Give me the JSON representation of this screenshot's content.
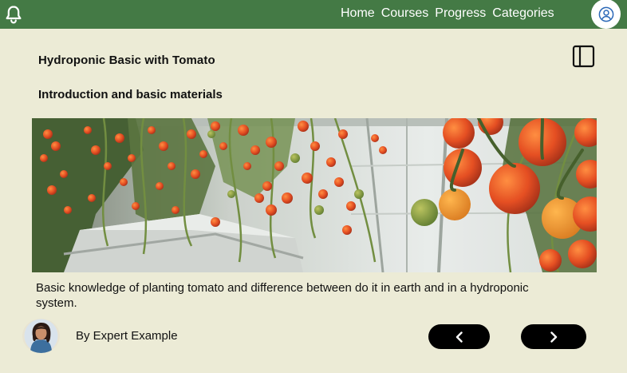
{
  "header": {
    "notification_icon": "bell-icon",
    "nav_items": [
      "Home",
      "Courses",
      "Progress",
      "Categories"
    ],
    "profile_icon": "user-circle-icon",
    "bar_color": "#447a45"
  },
  "course": {
    "title": "Hydroponic Basic with Tomato",
    "sidebar_icon": "sidebar-panel-icon"
  },
  "lesson": {
    "title": "Introduction and basic materials",
    "image_icon": "tomato-greenhouse-photo",
    "description": "Basic knowledge of planting tomato and difference between do it in earth and in a hydroponic system."
  },
  "author": {
    "byline": "By Expert Example",
    "avatar_icon": "author-avatar"
  },
  "pagination": {
    "prev_icon": "chevron-left-icon",
    "next_icon": "chevron-right-icon"
  },
  "colors": {
    "background": "#ecebd6",
    "button": "#000000"
  }
}
